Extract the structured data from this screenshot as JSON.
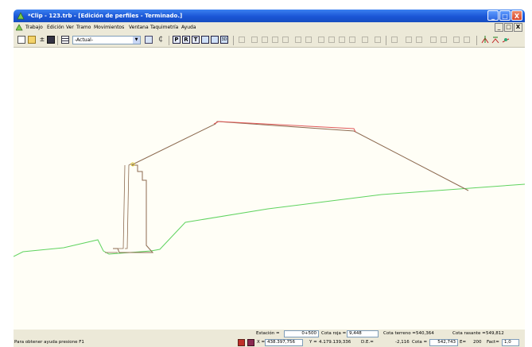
{
  "window": {
    "title": "*Clip - 123.trb - [Edición de perfiles - Terminado.]"
  },
  "menu": [
    "Trabajo",
    "Edición",
    "Ver",
    "Tramo",
    "Movimientos",
    "Ventana",
    "Taquimetría",
    "Ayuda"
  ],
  "mdi_buttons": [
    "_",
    "□",
    "X"
  ],
  "toolbar": {
    "combo_value": "-Actual-"
  },
  "status": {
    "help": "Para obtener ayuda presione F1",
    "estacion_label": "Estación =",
    "estacion_value": "0+500",
    "cota_roja_label": "Cota roja =",
    "cota_roja_value": "9,448",
    "cota_terreno_label": "Cota terreno =",
    "cota_terreno_value": "540,364",
    "cota_rasante_label": "Cota rasante =",
    "cota_rasante_value": "549,812",
    "x_label": "X =",
    "x_value": "438.397,756",
    "y_label": "Y =",
    "y_value": "4.179.139,336",
    "de_label": "D.E.=",
    "de_value": "-2,116",
    "cota_label": "Cota =",
    "cota_value": "542,743",
    "e_label": "E=",
    "e_value": "200",
    "fact_label": "Fact=",
    "fact_value": "1,0"
  },
  "colors": {
    "terrain": "#5fd35f",
    "profile": "#8c6a50",
    "highlight": "#e05a5a",
    "titlebar": "#1a56d6"
  }
}
